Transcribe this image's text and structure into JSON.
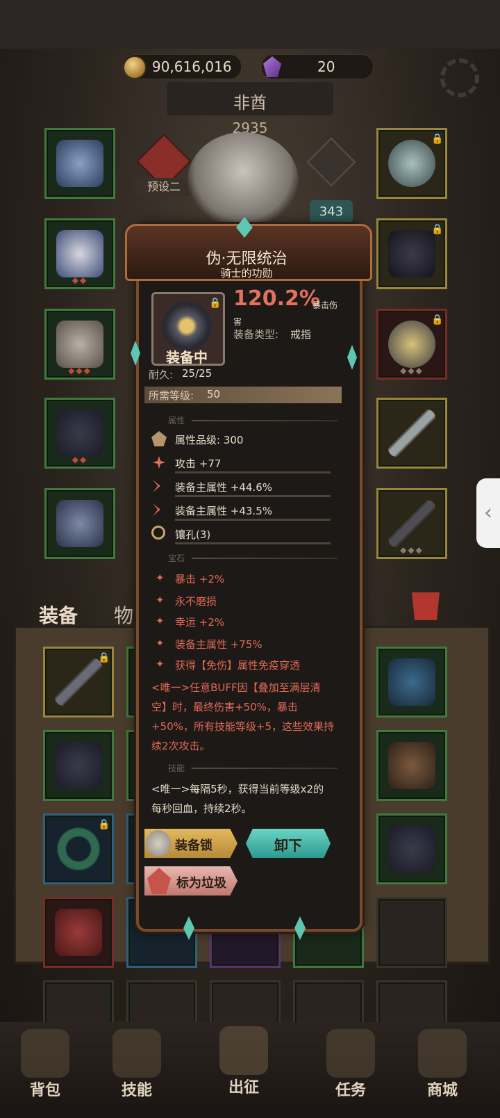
{
  "currency": {
    "gold": "90,616,016",
    "gems": "20"
  },
  "hero": {
    "name": "非酋",
    "power": "2935",
    "preset_label": "预设二",
    "level_badge": "343"
  },
  "inventory_tabs": {
    "equip": "装备",
    "items": "物品"
  },
  "tooltip": {
    "name": "伪·无限统治",
    "subtitle": "骑士的功勋",
    "main_stat_value": "120.2%",
    "main_stat_label_a": "暴击伤",
    "main_stat_label_b": "害",
    "type_label": "装备类型:",
    "type_value": "戒指",
    "equipped_tag": "装备中",
    "durability_label": "耐久:",
    "durability_value": "25/25",
    "req_level_label": "所需等级:",
    "req_level_value": "50",
    "attributes_title": "属性",
    "attributes": [
      "属性品级: 300",
      "攻击 +77",
      "装备主属性 +44.6%",
      "装备主属性 +43.5%",
      "镶孔(3)"
    ],
    "gems_title": "宝石",
    "gems": [
      "暴击 +2%",
      "永不磨损",
      "幸运 +2%",
      "装备主属性 +75%",
      "获得【免伤】属性免疫穿透"
    ],
    "unique_lines": [
      "<唯一>任意BUFF因【叠加至满层清",
      "空】时，最终伤害+50%，暴击",
      "+50%，所有技能等级+5，这些效果持",
      "续2次攻击。"
    ],
    "skills_title": "技能",
    "skill_lines": [
      "<唯一>每隔5秒，获得当前等级x2的",
      "每秒回血，持续2秒。"
    ],
    "btn_lock": "装备锁",
    "btn_unequip": "卸下",
    "btn_trash": "标为垃圾"
  },
  "nav": [
    {
      "label": "背包",
      "icon": "backpack-icon"
    },
    {
      "label": "技能",
      "icon": "skill-book-icon"
    },
    {
      "label": "出征",
      "icon": "sword-icon"
    },
    {
      "label": "任务",
      "icon": "scroll-icon"
    },
    {
      "label": "商城",
      "icon": "shop-crown-icon"
    }
  ],
  "colors": {
    "accent_red": "#e06a55",
    "frame_green": "#3f7a3c",
    "frame_gold": "#9b8538"
  }
}
